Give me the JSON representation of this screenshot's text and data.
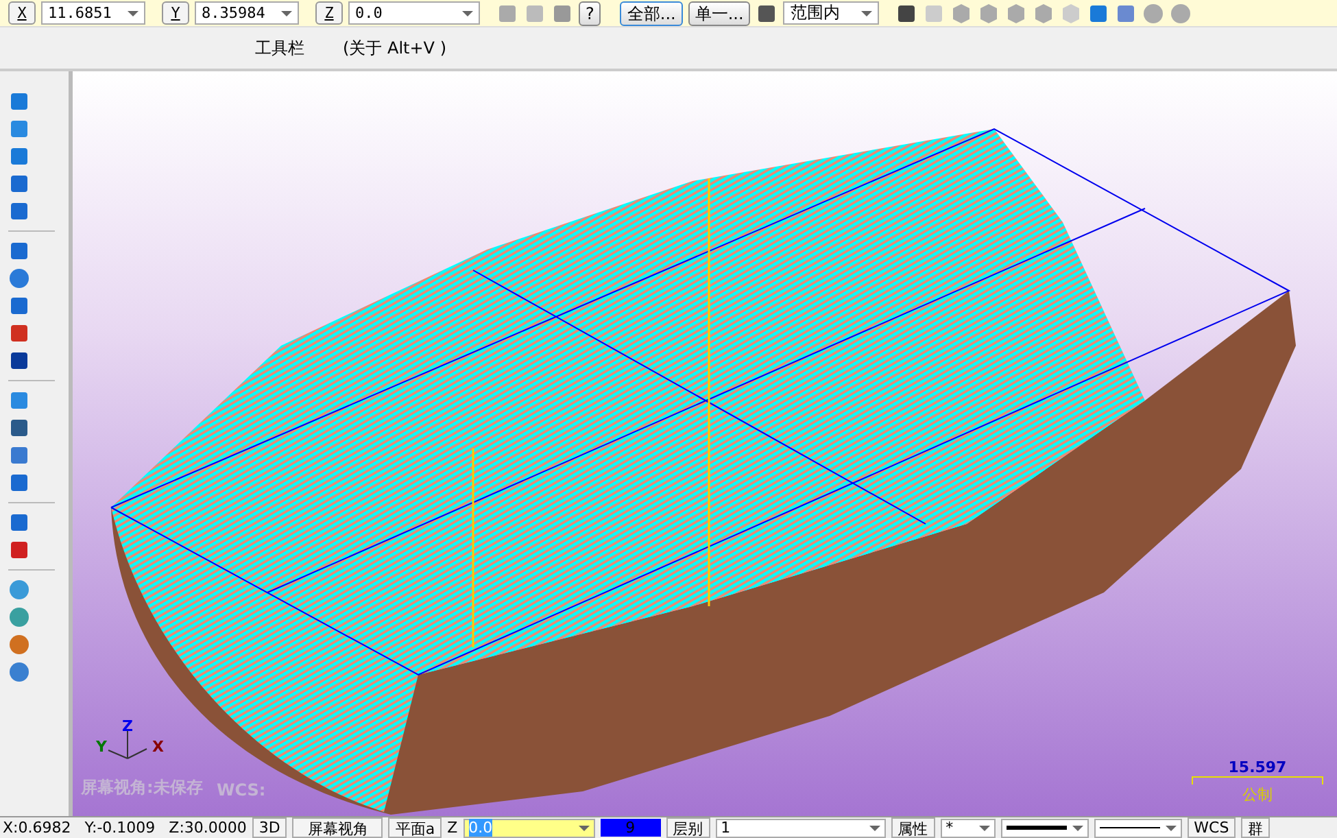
{
  "coord_toolbar": {
    "fields": [
      {
        "axis": "X",
        "value": "11.6851"
      },
      {
        "axis": "Y",
        "value": "8.35984"
      },
      {
        "axis": "Z",
        "value": "0.0"
      }
    ],
    "help": "?",
    "select_all": "全部...",
    "select_single": "单一...",
    "range": "范围内"
  },
  "toolbar_hint": {
    "title": "工具栏",
    "shortcut": "(关于 Alt+V )"
  },
  "viewport": {
    "view_status": "屏幕视角:未保存",
    "wcs": "WCS:",
    "axes": {
      "x": "X",
      "y": "Y",
      "z": "Z"
    },
    "scale": {
      "value": "15.597",
      "unit": "公制"
    }
  },
  "status_bar": {
    "x": "X:0.6982",
    "y": "Y:-0.1009",
    "z": "Z:30.0000",
    "mode": "3D",
    "view": "屏幕视角",
    "plane": "平面a",
    "z_label": "Z",
    "z_value": "0.0",
    "color_number": "9",
    "level_label": "层别",
    "level_value": "1",
    "attributes": "属性",
    "point_style": "*",
    "wcs": "WCS",
    "group": "群"
  }
}
